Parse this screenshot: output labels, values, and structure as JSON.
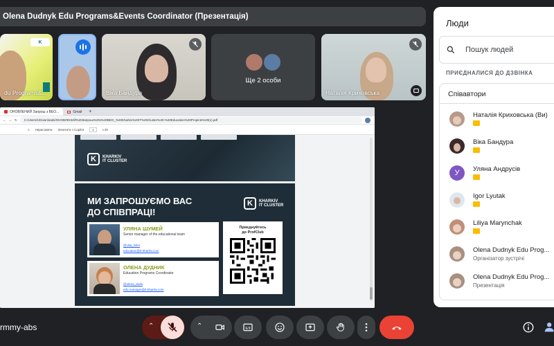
{
  "meeting": {
    "presentation_title": "Olena Dudnyk Edu Programs&Events Coordinator (Презентація)",
    "meeting_code": "rmmy-abs"
  },
  "tiles": [
    {
      "name": "du Programs&...",
      "muted": false
    },
    {
      "name": "",
      "speaking": true
    },
    {
      "name": "Віка Бандура",
      "muted": true
    },
    {
      "name": "Ще 2 особи",
      "muted": false
    },
    {
      "name": "Наталія Криховська",
      "muted": true
    }
  ],
  "browser": {
    "tabs": [
      {
        "label": "ОНОВЛЕНИЙ Запрош з ВЕО..."
      },
      {
        "label": "Gmail"
      }
    ],
    "url": "C:/Users/1/Downloads/ОНОВЛЕНИЙ%20Запрош%20з%20ВЕО_%20Kharkiv%20IT%20Cluster%20-%20Education%20Projects%20(1).pdf",
    "pdf_toolbar": [
      "Нарисовати",
      "Зачитати з Copilot",
      "1",
      "з 20"
    ]
  },
  "slide": {
    "logo_k": "K",
    "logo_line1": "KHARKIV",
    "logo_line2": "IT CLUSTER",
    "invite_text": "МИ ЗАПРОШУЄМО ВАС\nДО СПІВПРАЦІ!",
    "cards": [
      {
        "name": "УЛЯНА ШУМЕЙ",
        "role": "Senior manager of the educational team",
        "link1": "@Ulia_Shm",
        "link2": "education@it-kharkiv.com"
      },
      {
        "name": "ОЛЕНА ДУДНИК",
        "role": "Education Programs Coordinator",
        "link1": "@olena_dudn",
        "link2": "edu.manager@it-kharkiv.com"
      }
    ],
    "qr_caption": "Приєднуйтесь\nдо ProfClub"
  },
  "panel": {
    "title": "Люди",
    "search_placeholder": "Пошук людей",
    "section_label": "ПРИЄДНАЛИСЯ ДО ДЗВІНКА",
    "list_header": "Співавтори",
    "people": [
      {
        "name": "Наталія Криховська (Ви)",
        "subtitle": "",
        "badge": true,
        "avatar_color": "#b89a8a"
      },
      {
        "name": "Віка Бандура",
        "subtitle": "",
        "badge": true,
        "avatar_color": "#3a2a2a"
      },
      {
        "name": "Уляна Андрусів",
        "subtitle": "",
        "badge": true,
        "avatar_color": "#7e57c2",
        "initial": "У"
      },
      {
        "name": "Igor Lyutak",
        "subtitle": "",
        "badge": true,
        "avatar_color": "#5c7da3"
      },
      {
        "name": "Liliya Marynchak",
        "subtitle": "",
        "badge": true,
        "avatar_color": "#c08f7a"
      },
      {
        "name": "Olena Dudnyk Edu Prog...",
        "subtitle": "Організатор зустрічі",
        "badge": false,
        "avatar_color": "#a89080"
      },
      {
        "name": "Olena Dudnyk Edu Prog...",
        "subtitle": "Презентація",
        "badge": false,
        "avatar_color": "#a89080"
      }
    ]
  },
  "colors": {
    "background": "#202124",
    "end_call": "#ea4335",
    "muted_mic_bg": "#f9dedc",
    "speaking": "#1a73e8",
    "badge": "#fbbc04"
  }
}
